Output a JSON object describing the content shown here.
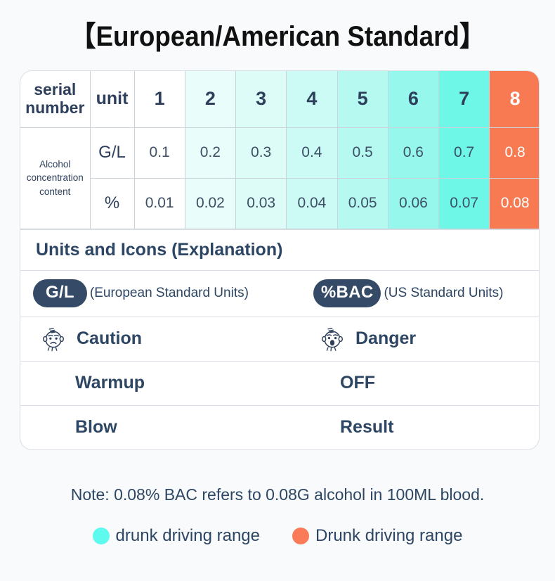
{
  "title": "【European/American Standard】",
  "table": {
    "header": {
      "serial_number": "serial\nnumber",
      "serial_number_line1": "serial",
      "serial_number_line2": "number",
      "unit": "unit",
      "columns": [
        "1",
        "2",
        "3",
        "4",
        "5",
        "6",
        "7",
        "8"
      ]
    },
    "row_group_label_line1": "Alcohol",
    "row_group_label_line2": "concentration",
    "row_group_label_line3": "content",
    "rows": [
      {
        "unit": "G/L",
        "values": [
          "0.1",
          "0.2",
          "0.3",
          "0.4",
          "0.5",
          "0.6",
          "0.7",
          "0.8"
        ]
      },
      {
        "unit": "%",
        "values": [
          "0.01",
          "0.02",
          "0.03",
          "0.04",
          "0.05",
          "0.06",
          "0.07",
          "0.08"
        ]
      }
    ]
  },
  "explanation": {
    "section_title": "Units and Icons (Explanation)",
    "units": [
      {
        "badge": "G/L",
        "note": "(European Standard Units)"
      },
      {
        "badge": "%BAC",
        "note": "(US Standard Units)"
      }
    ],
    "states": [
      {
        "icon": "worried-face-icon",
        "label": "Caution"
      },
      {
        "icon": "shocked-face-icon",
        "label": "Danger"
      }
    ],
    "warmup": {
      "left": "Warmup",
      "right": "OFF"
    },
    "blow": {
      "left": "Blow",
      "right": "Result"
    }
  },
  "footer": {
    "note": "Note: 0.08% BAC refers to 0.08G alcohol in 100ML blood.",
    "legend": [
      {
        "color": "#5ffaee",
        "label": "drunk driving range"
      },
      {
        "color": "#f97b57",
        "label": "Drunk driving range"
      }
    ]
  },
  "colors": {
    "cyan": "#5ffaee",
    "orange": "#f77a52",
    "text_navy": "#2d4663",
    "badge_navy": "#344a66",
    "background": "#f8fafb"
  }
}
